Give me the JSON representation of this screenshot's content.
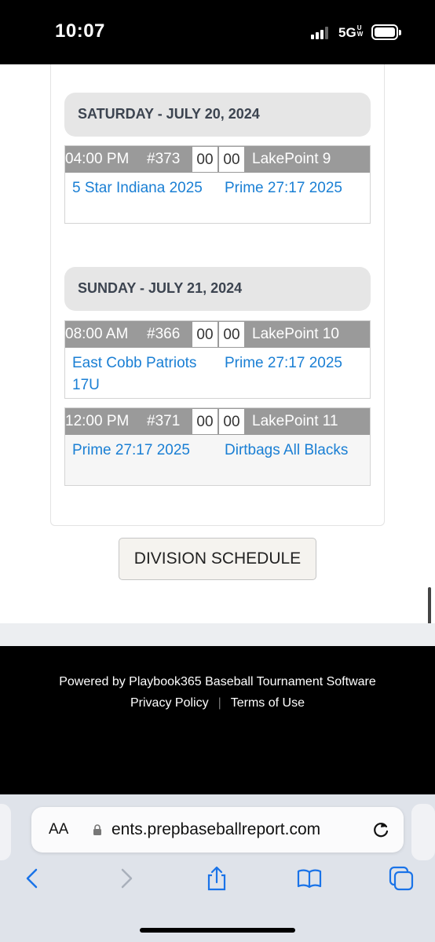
{
  "status_bar": {
    "time": "10:07",
    "network": "5G",
    "network_sub": "UW"
  },
  "days": [
    {
      "header": "SATURDAY - JULY 20, 2024",
      "games": [
        {
          "time": "04:00 PM",
          "number": "#373",
          "score1": "00",
          "score2": "00",
          "field": "LakePoint 9",
          "team1": "5 Star Indiana 2025",
          "team2": "Prime 27:17 2025"
        }
      ]
    },
    {
      "header": "SUNDAY - JULY 21, 2024",
      "games": [
        {
          "time": "08:00 AM",
          "number": "#366",
          "score1": "00",
          "score2": "00",
          "field": "LakePoint 10",
          "team1": "East Cobb Patriots 17U",
          "team2": "Prime 27:17 2025"
        },
        {
          "time": "12:00 PM",
          "number": "#371",
          "score1": "00",
          "score2": "00",
          "field": "LakePoint 11",
          "team1": "Prime 27:17 2025",
          "team2": "Dirtbags All Blacks"
        }
      ]
    }
  ],
  "division_button": "DIVISION SCHEDULE",
  "footer": {
    "powered": "Powered by Playbook365 Baseball Tournament Software",
    "privacy": "Privacy Policy",
    "separator": "|",
    "terms": "Terms of Use"
  },
  "browser": {
    "aa_label": "AA",
    "url": "ents.prepbaseballreport.com"
  },
  "icons": [
    "signal-icon",
    "battery-icon",
    "lock-icon",
    "reload-icon",
    "back-icon",
    "forward-icon",
    "share-icon",
    "bookmarks-icon",
    "tabs-icon"
  ]
}
